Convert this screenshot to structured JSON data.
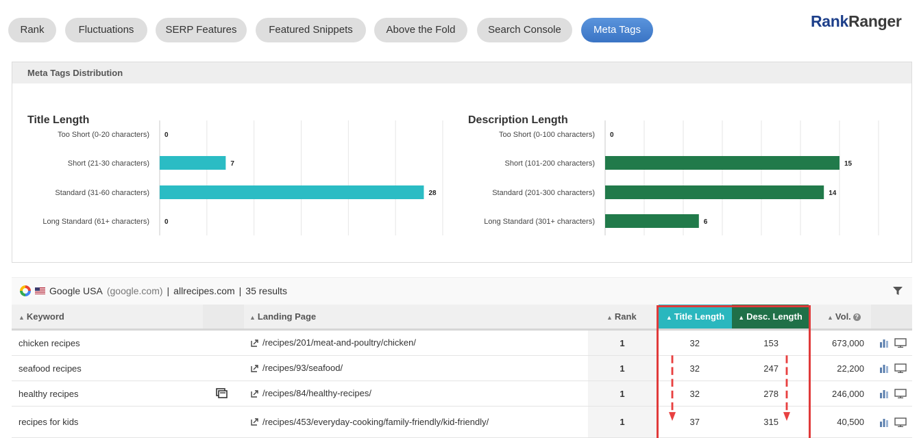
{
  "tabs": [
    {
      "label": "Rank",
      "active": false
    },
    {
      "label": "Fluctuations",
      "active": false
    },
    {
      "label": "SERP Features",
      "active": false
    },
    {
      "label": "Featured Snippets",
      "active": false
    },
    {
      "label": "Above the Fold",
      "active": false
    },
    {
      "label": "Search Console",
      "active": false
    },
    {
      "label": "Meta Tags",
      "active": true
    }
  ],
  "logo": {
    "part1": "Rank",
    "part2": "Ranger"
  },
  "panel": {
    "title": "Meta Tags Distribution"
  },
  "chart_data": [
    {
      "type": "bar",
      "orientation": "horizontal",
      "title": "Title Length",
      "categories": [
        "Too Short (0-20 characters)",
        "Short (21-30 characters)",
        "Standard (31-60 characters)",
        "Long Standard (61+ characters)"
      ],
      "values": [
        0,
        7,
        28,
        0
      ],
      "xlim": [
        0,
        30
      ],
      "ticks": [
        0,
        5,
        10,
        15,
        20,
        25,
        30
      ],
      "color": "#2bbcc4",
      "grid": true
    },
    {
      "type": "bar",
      "orientation": "horizontal",
      "title": "Description Length",
      "categories": [
        "Too Short (0-100 characters)",
        "Short (101-200 characters)",
        "Standard (201-300 characters)",
        "Long Standard (301+ characters)"
      ],
      "values": [
        0,
        15,
        14,
        6
      ],
      "xlim": [
        0,
        17.5
      ],
      "ticks": [
        0,
        2.5,
        5,
        7.5,
        10,
        12.5,
        15,
        17.5
      ],
      "color": "#217a4a",
      "grid": true
    }
  ],
  "results": {
    "engine": "Google USA",
    "domain_hint": "(google.com)",
    "sep1": "|",
    "site": "allrecipes.com",
    "sep2": "|",
    "count": "35 results"
  },
  "table": {
    "headers": {
      "keyword": "Keyword",
      "landing": "Landing Page",
      "rank": "Rank",
      "title": "Title Length",
      "desc": "Desc. Length",
      "vol": "Vol."
    },
    "rows": [
      {
        "keyword": "chicken recipes",
        "landing": "/recipes/201/meat-and-poultry/chicken/",
        "rank": "1",
        "title": "32",
        "desc": "153",
        "vol": "673,000",
        "extra_icon": false
      },
      {
        "keyword": "seafood recipes",
        "landing": "/recipes/93/seafood/",
        "rank": "1",
        "title": "32",
        "desc": "247",
        "vol": "22,200",
        "extra_icon": false
      },
      {
        "keyword": "healthy recipes",
        "landing": "/recipes/84/healthy-recipes/",
        "rank": "1",
        "title": "32",
        "desc": "278",
        "vol": "246,000",
        "extra_icon": true
      },
      {
        "keyword": "recipes for kids",
        "landing": "/recipes/453/everyday-cooking/family-friendly/kid-friendly/",
        "rank": "1",
        "title": "37",
        "desc": "315",
        "vol": "40,500",
        "extra_icon": false
      }
    ]
  },
  "colors": {
    "accent": "#3f7fd0",
    "title_bar": "#2bbcc4",
    "desc_bar": "#217a4a",
    "highlight": "#e03a3a"
  }
}
